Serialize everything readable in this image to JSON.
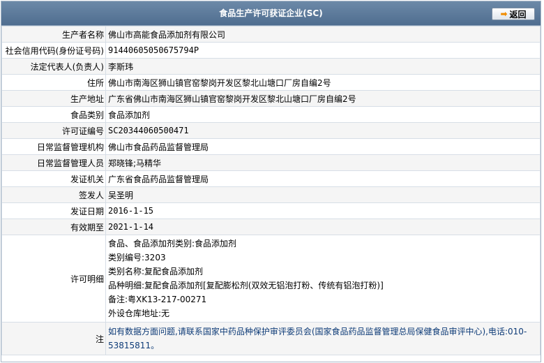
{
  "header": {
    "title": "食品生产许可获证企业(SC)",
    "back_label": "返回"
  },
  "rows": {
    "producer": {
      "label": "生产者名称",
      "value": "佛山市高能食品添加剂有限公司"
    },
    "credit_code": {
      "label": "社会信用代码(身份证号码)",
      "value": "91440605050675794P"
    },
    "legal_rep": {
      "label": "法定代表人(负责人)",
      "value": "李斯玮"
    },
    "address": {
      "label": "住所",
      "value": "佛山市南海区狮山镇官窑黎岗开发区黎北山塘口厂房自编2号"
    },
    "prod_address": {
      "label": "生产地址",
      "value": "广东省佛山市南海区狮山镇官窑黎岗开发区黎北山塘口厂房自编2号"
    },
    "food_category": {
      "label": "食品类别",
      "value": "食品添加剂"
    },
    "license_no": {
      "label": "许可证编号",
      "value": "SC20344060500471"
    },
    "supervision_org": {
      "label": "日常监督管理机构",
      "value": "佛山市食品药品监督管理局"
    },
    "supervision_staff": {
      "label": "日常监督管理人员",
      "value": "郑晓锋;马精华"
    },
    "issuer_org": {
      "label": "发证机关",
      "value": "广东省食品药品监督管理局"
    },
    "signer": {
      "label": "签发人",
      "value": "吴圣明"
    },
    "issue_date": {
      "label": "发证日期",
      "value": "2016-1-15"
    },
    "expiry_date": {
      "label": "有效期至",
      "value": "2021-1-14"
    },
    "license_detail": {
      "label": "许可明细",
      "lines": [
        "食品、食品添加剂类别:食品添加剂",
        "类别编号:3203",
        "类别名称:复配食品添加剂",
        "品种明细:复配食品添加剂[复配膨松剂(双效无铝泡打粉、传统有铝泡打粉)]",
        "备注:粤XK13-217-00271",
        "外设仓库地址:无"
      ]
    },
    "note": {
      "label": "注",
      "value": "如有数据方面问题,请联系国家中药品种保护审评委员会(国家食品药品监督管理总局保健食品审评中心),电话:010-53815811。"
    }
  }
}
